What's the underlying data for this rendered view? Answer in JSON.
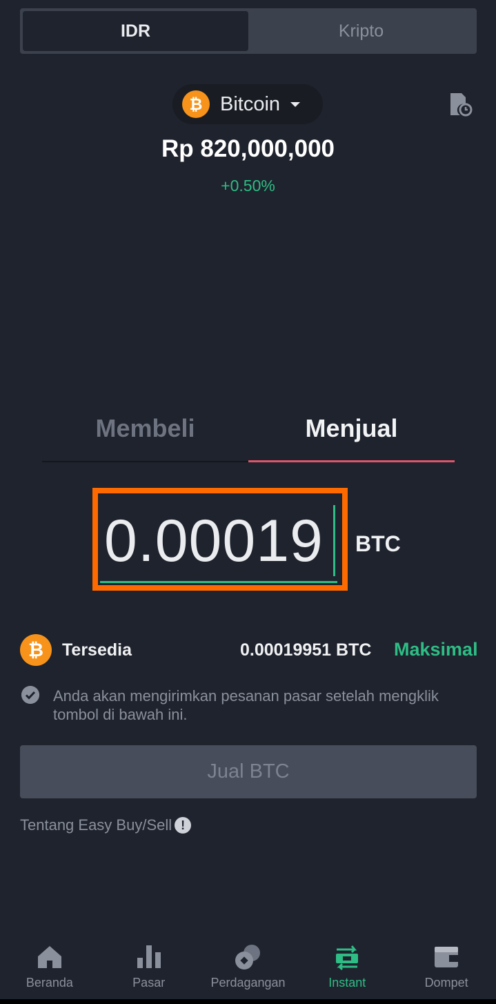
{
  "currency_toggle": {
    "left": "IDR",
    "right": "Kripto",
    "active": "IDR"
  },
  "coin": {
    "symbol_glyph": "₿",
    "name": "Bitcoin"
  },
  "ticker": {
    "price": "Rp 820,000,000",
    "change": "+0.50%"
  },
  "trade_tabs": {
    "buy": "Membeli",
    "sell": "Menjual",
    "active": "sell"
  },
  "amount": {
    "value": "0.00019",
    "unit": "BTC"
  },
  "available": {
    "label": "Tersedia",
    "value": "0.00019951 BTC",
    "max": "Maksimal"
  },
  "notice": "Anda akan mengirimkan pesanan pasar setelah mengklik tombol di bawah ini.",
  "action_button": "Jual BTC",
  "about_link": "Tentang Easy Buy/Sell",
  "nav": [
    {
      "label": "Beranda",
      "icon": "home-icon"
    },
    {
      "label": "Pasar",
      "icon": "market-bars-icon"
    },
    {
      "label": "Perdagangan",
      "icon": "trade-coins-icon"
    },
    {
      "label": "Instant",
      "icon": "instant-swap-icon"
    },
    {
      "label": "Dompet",
      "icon": "wallet-icon"
    }
  ],
  "colors": {
    "background": "#1f232d",
    "positive": "#2ebd85",
    "sell_accent": "#e0556a",
    "bitcoin": "#f7931a",
    "highlight_box": "#ff6a00"
  }
}
